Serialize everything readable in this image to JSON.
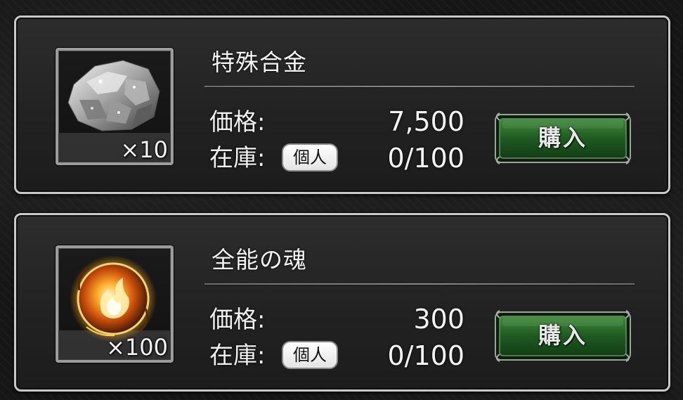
{
  "shop": {
    "items": [
      {
        "name": "特殊合金",
        "icon": "alloy-ore-icon",
        "quantity": "×10",
        "price_label": "価格:",
        "price": "7,500",
        "stock_label": "在庫:",
        "stock_type": "個人",
        "stock": "0/100",
        "buy_label": "購入"
      },
      {
        "name": "全能の魂",
        "icon": "soul-orb-icon",
        "quantity": "×100",
        "price_label": "価格:",
        "price": "300",
        "stock_label": "在庫:",
        "stock_type": "個人",
        "stock": "0/100",
        "buy_label": "購入"
      }
    ]
  },
  "colors": {
    "background": "#161616",
    "card_border": "#c9c9c9",
    "buy_button": "#1f5a22",
    "buy_button_border": "#7a8f78",
    "text": "#f3f3f3"
  }
}
